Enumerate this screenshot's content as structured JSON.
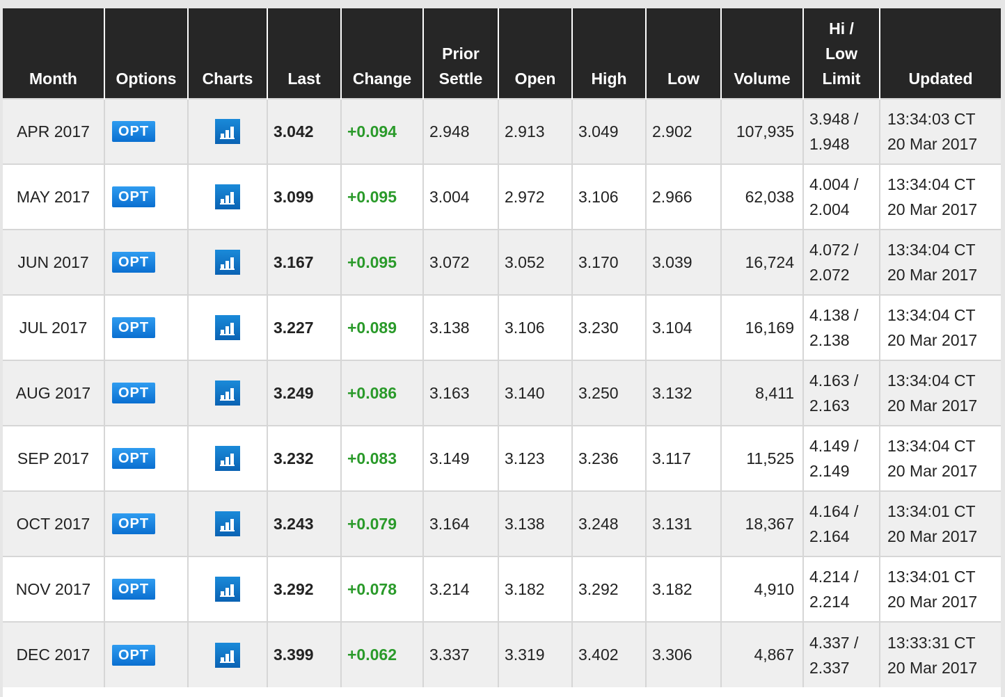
{
  "colors": {
    "positive_change": "#2a9a2a",
    "header_bg": "#262626",
    "opt_button": "#1a86e0"
  },
  "headers": {
    "month": "Month",
    "options": "Options",
    "charts": "Charts",
    "last": "Last",
    "change": "Change",
    "prior_settle_1": "Prior",
    "prior_settle_2": "Settle",
    "open": "Open",
    "high": "High",
    "low": "Low",
    "volume": "Volume",
    "limit_1": "Hi /",
    "limit_2": "Low",
    "limit_3": "Limit",
    "updated": "Updated"
  },
  "rows": [
    {
      "month": "APR 2017",
      "opt": "OPT",
      "last": "3.042",
      "change": "+0.094",
      "prior": "2.948",
      "open": "2.913",
      "high": "3.049",
      "low": "2.902",
      "volume": "107,935",
      "hi": "3.948 /",
      "lo": "1.948",
      "time": "13:34:03 CT",
      "date": "20 Mar 2017"
    },
    {
      "month": "MAY 2017",
      "opt": "OPT",
      "last": "3.099",
      "change": "+0.095",
      "prior": "3.004",
      "open": "2.972",
      "high": "3.106",
      "low": "2.966",
      "volume": "62,038",
      "hi": "4.004 /",
      "lo": "2.004",
      "time": "13:34:04 CT",
      "date": "20 Mar 2017"
    },
    {
      "month": "JUN 2017",
      "opt": "OPT",
      "last": "3.167",
      "change": "+0.095",
      "prior": "3.072",
      "open": "3.052",
      "high": "3.170",
      "low": "3.039",
      "volume": "16,724",
      "hi": "4.072 /",
      "lo": "2.072",
      "time": "13:34:04 CT",
      "date": "20 Mar 2017"
    },
    {
      "month": "JUL 2017",
      "opt": "OPT",
      "last": "3.227",
      "change": "+0.089",
      "prior": "3.138",
      "open": "3.106",
      "high": "3.230",
      "low": "3.104",
      "volume": "16,169",
      "hi": "4.138 /",
      "lo": "2.138",
      "time": "13:34:04 CT",
      "date": "20 Mar 2017"
    },
    {
      "month": "AUG 2017",
      "opt": "OPT",
      "last": "3.249",
      "change": "+0.086",
      "prior": "3.163",
      "open": "3.140",
      "high": "3.250",
      "low": "3.132",
      "volume": "8,411",
      "hi": "4.163 /",
      "lo": "2.163",
      "time": "13:34:04 CT",
      "date": "20 Mar 2017"
    },
    {
      "month": "SEP 2017",
      "opt": "OPT",
      "last": "3.232",
      "change": "+0.083",
      "prior": "3.149",
      "open": "3.123",
      "high": "3.236",
      "low": "3.117",
      "volume": "11,525",
      "hi": "4.149 /",
      "lo": "2.149",
      "time": "13:34:04 CT",
      "date": "20 Mar 2017"
    },
    {
      "month": "OCT 2017",
      "opt": "OPT",
      "last": "3.243",
      "change": "+0.079",
      "prior": "3.164",
      "open": "3.138",
      "high": "3.248",
      "low": "3.131",
      "volume": "18,367",
      "hi": "4.164 /",
      "lo": "2.164",
      "time": "13:34:01 CT",
      "date": "20 Mar 2017"
    },
    {
      "month": "NOV 2017",
      "opt": "OPT",
      "last": "3.292",
      "change": "+0.078",
      "prior": "3.214",
      "open": "3.182",
      "high": "3.292",
      "low": "3.182",
      "volume": "4,910",
      "hi": "4.214 /",
      "lo": "2.214",
      "time": "13:34:01 CT",
      "date": "20 Mar 2017"
    },
    {
      "month": "DEC 2017",
      "opt": "OPT",
      "last": "3.399",
      "change": "+0.062",
      "prior": "3.337",
      "open": "3.319",
      "high": "3.402",
      "low": "3.306",
      "volume": "4,867",
      "hi": "4.337 /",
      "lo": "2.337",
      "time": "13:33:31 CT",
      "date": "20 Mar 2017"
    }
  ]
}
